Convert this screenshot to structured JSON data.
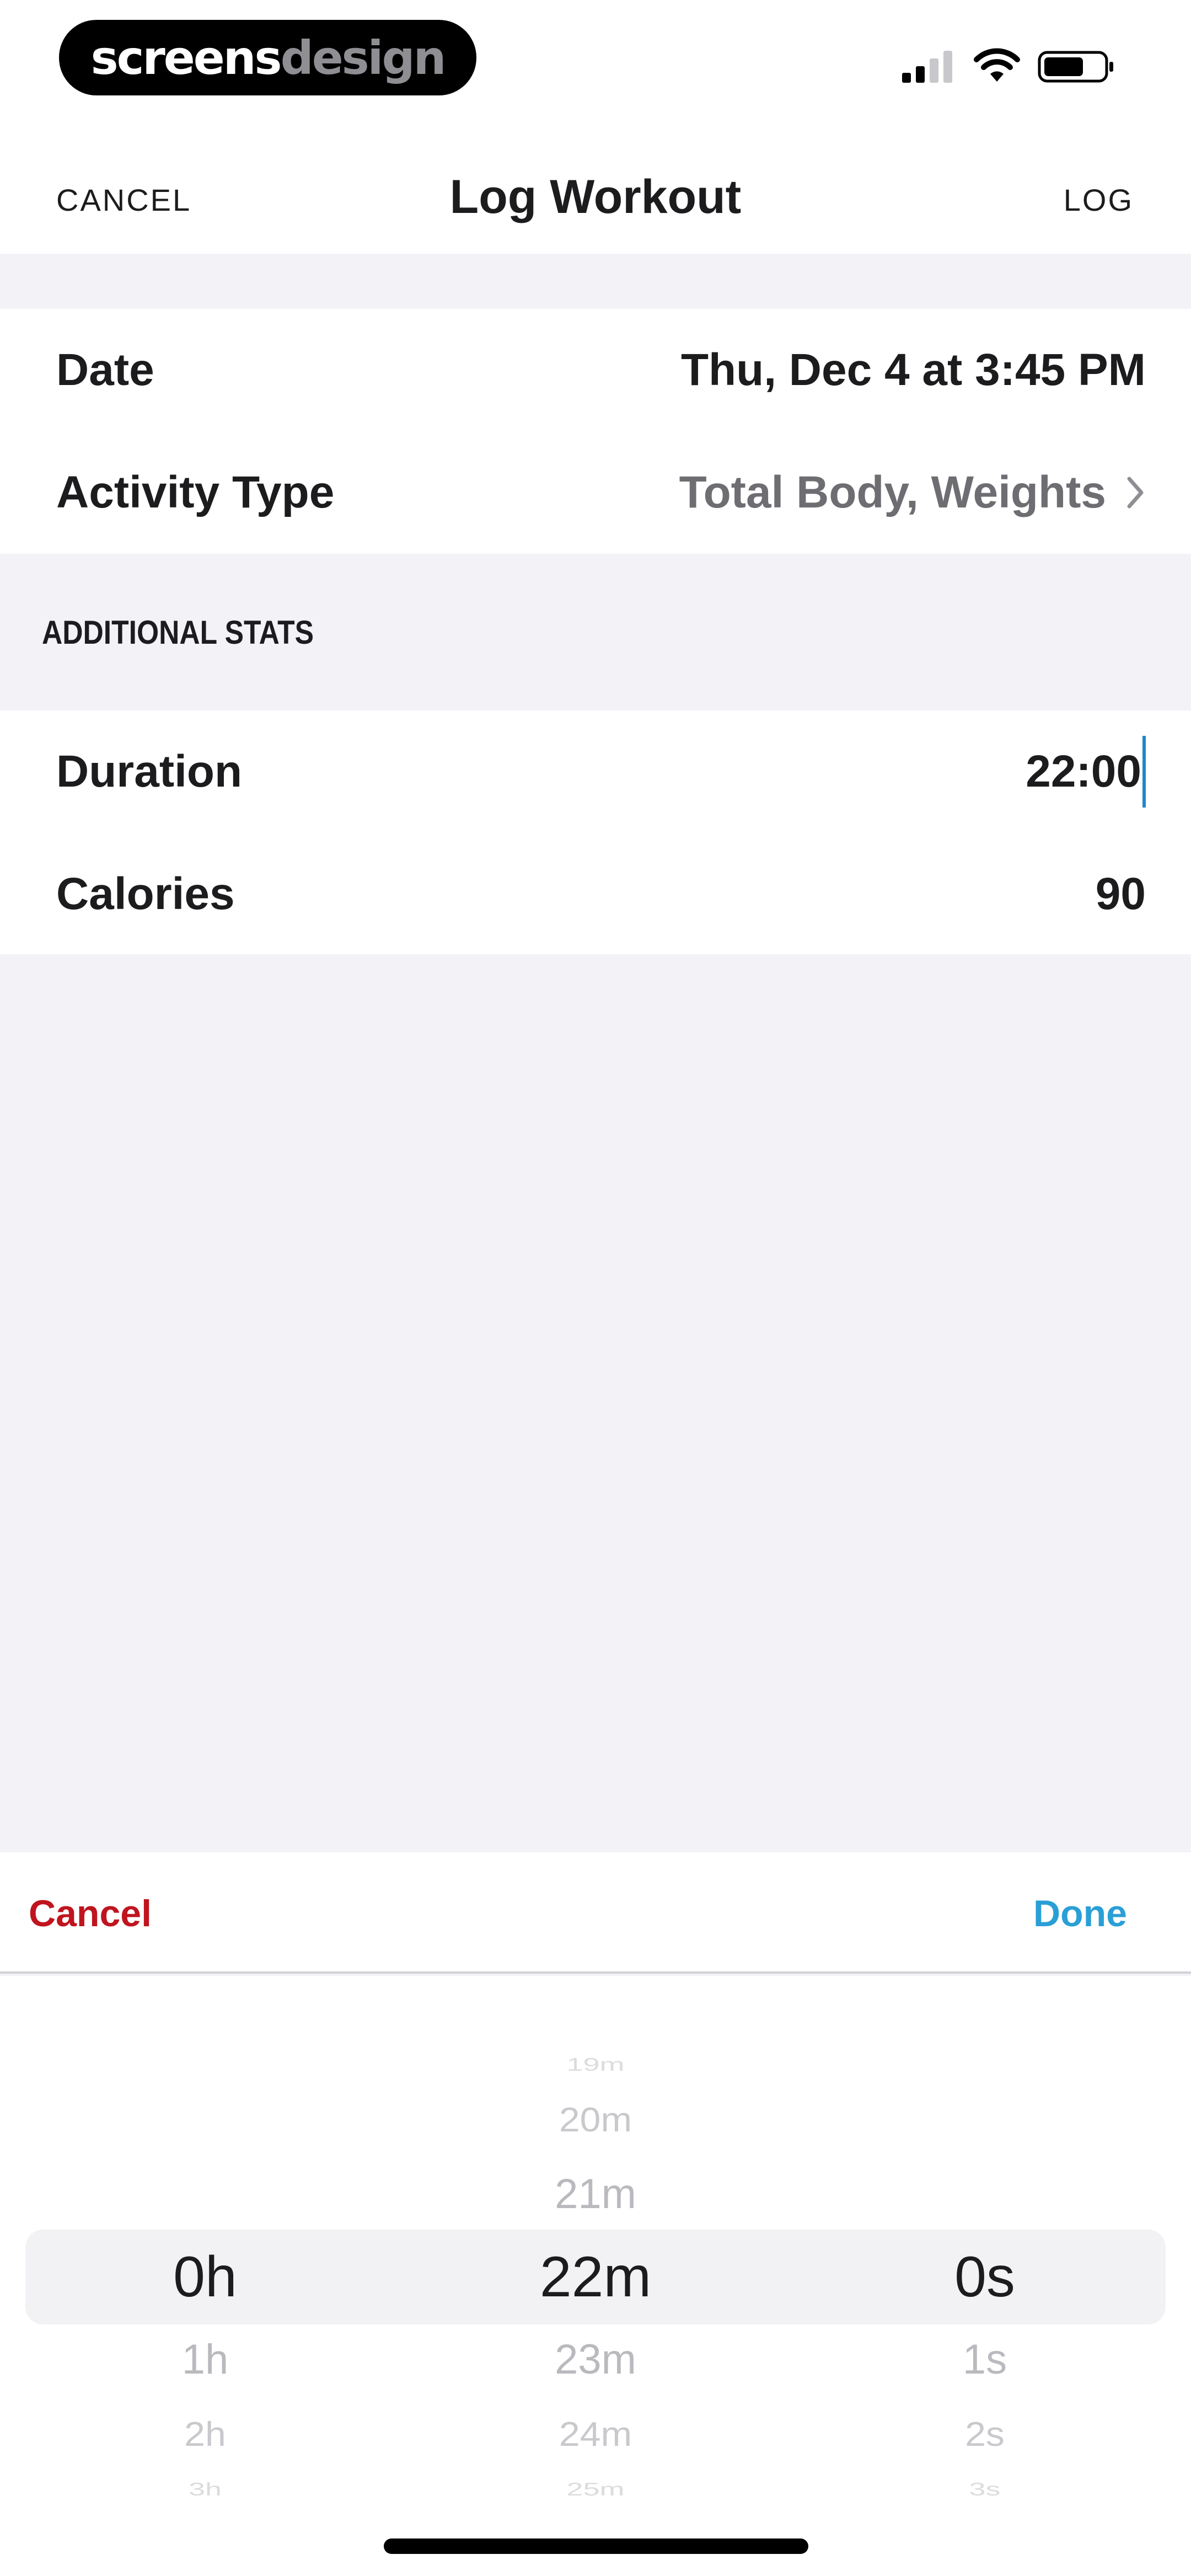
{
  "status_bar": {
    "brand_part1": "screens",
    "brand_part2": "design",
    "icons": [
      "cellular-signal-icon",
      "wifi-icon",
      "battery-icon"
    ]
  },
  "nav": {
    "cancel": "CANCEL",
    "title": "Log Workout",
    "log": "LOG"
  },
  "workout": {
    "date_label": "Date",
    "date_value": "Thu, Dec 4 at 3:45 PM",
    "activity_label": "Activity Type",
    "activity_value": "Total Body, Weights"
  },
  "additional_stats": {
    "header": "ADDITIONAL STATS",
    "duration_label": "Duration",
    "duration_value": "22:00",
    "calories_label": "Calories",
    "calories_value": "90"
  },
  "picker": {
    "cancel": "Cancel",
    "done": "Done",
    "hours": {
      "above": [],
      "selected": "0h",
      "below": [
        "1h",
        "2h",
        "3h"
      ]
    },
    "minutes": {
      "above": [
        "19m",
        "20m",
        "21m"
      ],
      "selected": "22m",
      "below": [
        "23m",
        "24m",
        "25m"
      ]
    },
    "seconds": {
      "above": [],
      "selected": "0s",
      "below": [
        "1s",
        "2s",
        "3s"
      ]
    }
  },
  "colors": {
    "accent_done": "#2a9fd6",
    "accent_cancel": "#c0141e",
    "caret": "#1e88c9",
    "background": "#f2f2f7"
  }
}
